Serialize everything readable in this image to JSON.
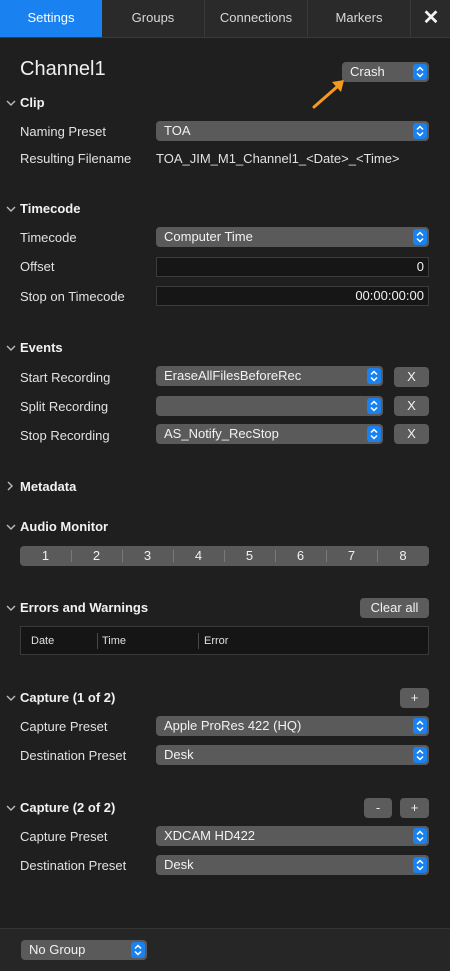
{
  "tabs": [
    "Settings",
    "Groups",
    "Connections",
    "Markers"
  ],
  "channel": {
    "title": "Channel1",
    "preset": "Crash"
  },
  "clip": {
    "heading": "Clip",
    "naming_label": "Naming Preset",
    "naming_value": "TOA",
    "filename_label": "Resulting Filename",
    "filename_value": "TOA_JIM_M1_Channel1_<Date>_<Time>"
  },
  "timecode": {
    "heading": "Timecode",
    "timecode_label": "Timecode",
    "timecode_value": "Computer Time",
    "offset_label": "Offset",
    "offset_value": "0",
    "stop_label": "Stop on Timecode",
    "stop_value": "00:00:00:00"
  },
  "events": {
    "heading": "Events",
    "rows": [
      {
        "label": "Start Recording",
        "value": "EraseAllFilesBeforeRec",
        "clear": "X"
      },
      {
        "label": "Split Recording",
        "value": "",
        "clear": "X"
      },
      {
        "label": "Stop Recording",
        "value": "AS_Notify_RecStop",
        "clear": "X"
      }
    ]
  },
  "metadata": {
    "heading": "Metadata"
  },
  "audio": {
    "heading": "Audio Monitor",
    "channels": [
      "1",
      "2",
      "3",
      "4",
      "5",
      "6",
      "7",
      "8"
    ]
  },
  "errors": {
    "heading": "Errors and Warnings",
    "clear_all": "Clear all",
    "columns": [
      "Date",
      "Time",
      "Error"
    ]
  },
  "capture1": {
    "heading": "Capture (1 of 2)",
    "add": "+",
    "capture_label": "Capture Preset",
    "capture_value": "Apple ProRes 422 (HQ)",
    "dest_label": "Destination Preset",
    "dest_value": "Desk"
  },
  "capture2": {
    "heading": "Capture (2 of 2)",
    "remove": "-",
    "add": "+",
    "capture_label": "Capture Preset",
    "capture_value": "XDCAM HD422",
    "dest_label": "Destination Preset",
    "dest_value": "Desk"
  },
  "footer": {
    "group": "No Group"
  },
  "colors": {
    "accent": "#1a82f0",
    "arrow": "#f59a1c",
    "background": "#1f1f1f"
  },
  "icons": [
    "close-icon",
    "chevron-down-icon",
    "chevron-right-icon",
    "stepper-icon",
    "arrow-annotation-icon"
  ]
}
